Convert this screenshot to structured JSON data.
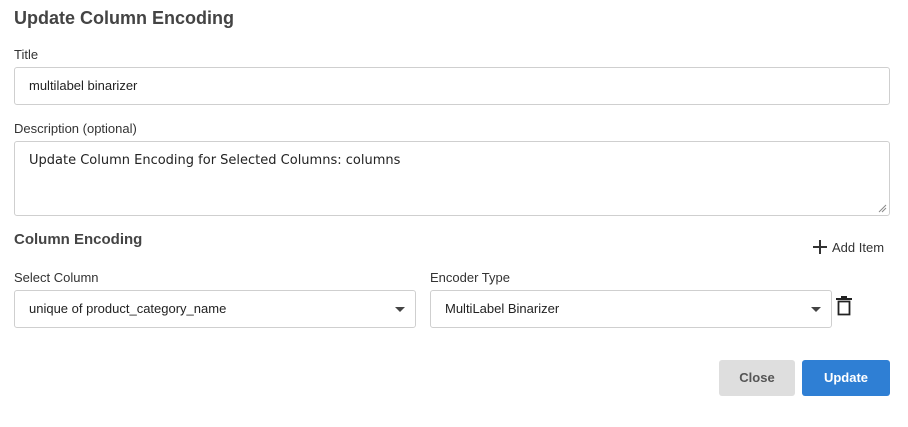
{
  "dialog": {
    "title": "Update Column Encoding"
  },
  "form": {
    "title_label": "Title",
    "title_value": "multilabel binarizer",
    "description_label": "Description (optional)",
    "description_value": "Update Column Encoding for Selected Columns: columns"
  },
  "encoding": {
    "section_title": "Column Encoding",
    "add_item_label": "Add Item",
    "rows": [
      {
        "column_label": "Select Column",
        "column_value": "unique of product_category_name",
        "encoder_label": "Encoder Type",
        "encoder_value": "MultiLabel Binarizer"
      }
    ]
  },
  "footer": {
    "close_label": "Close",
    "update_label": "Update"
  },
  "colors": {
    "primary": "#2f7fd4",
    "secondary": "#dedede"
  },
  "icons": [
    "plus-icon",
    "chevron-down-icon",
    "trash-icon",
    "resize-grip-icon"
  ]
}
